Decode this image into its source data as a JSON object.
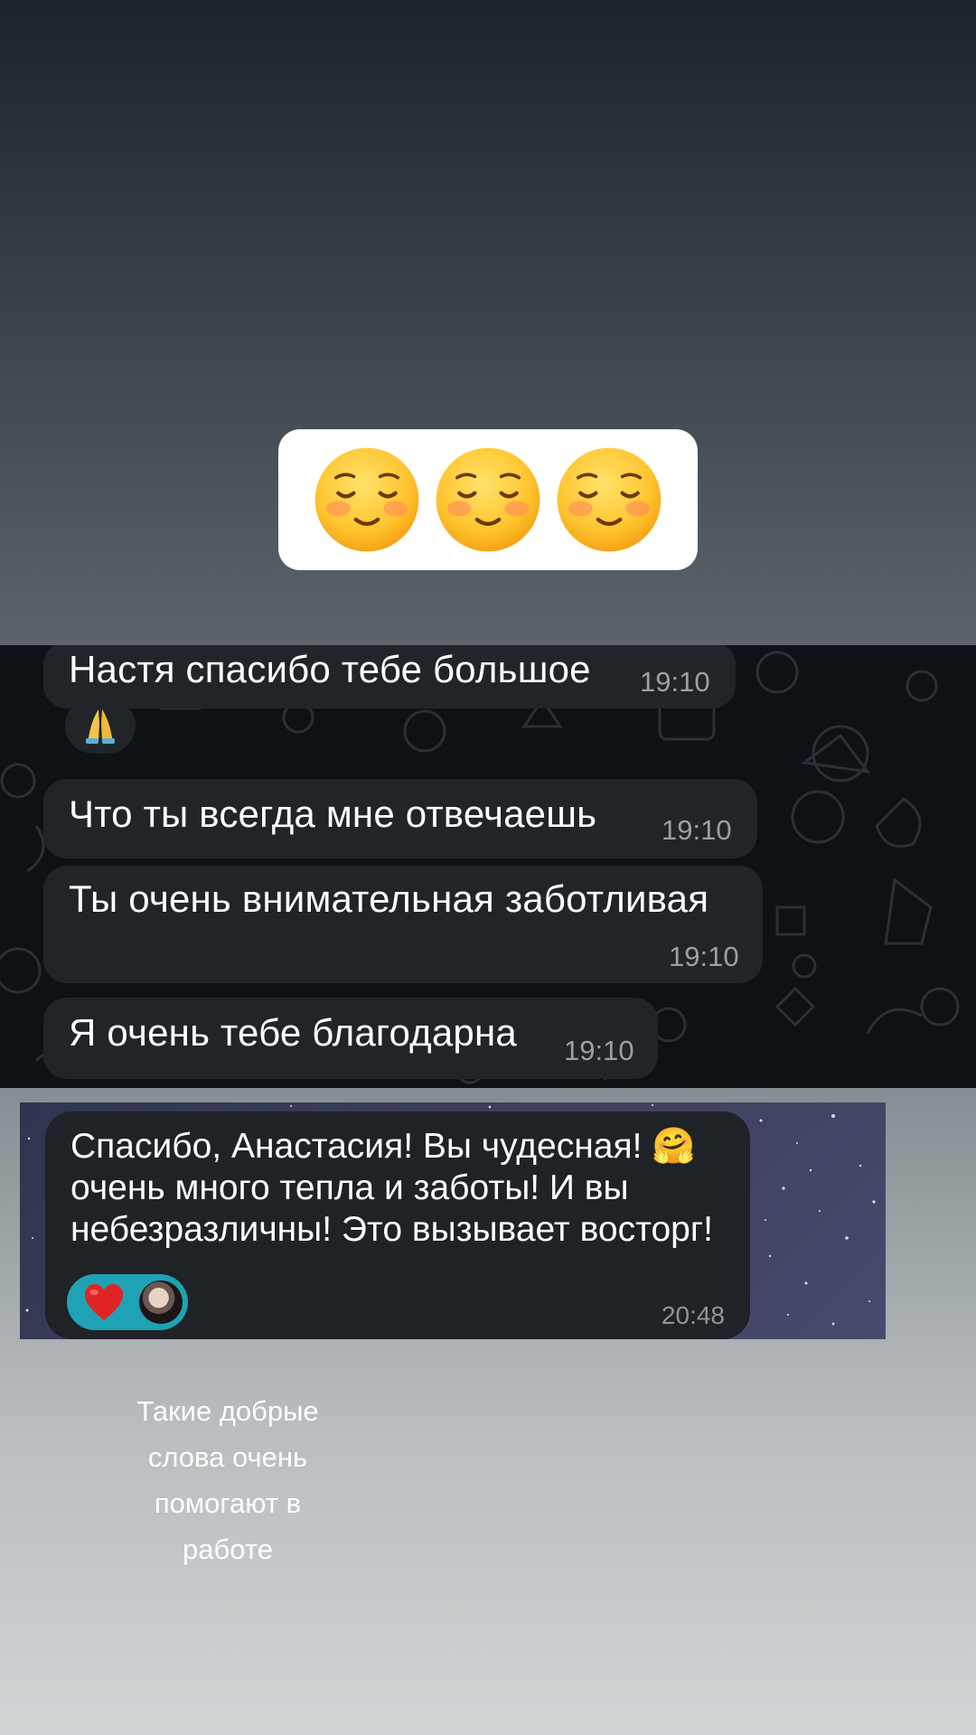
{
  "sticker": {
    "icons": [
      "smiling-face-icon",
      "smiling-face-icon",
      "smiling-face-icon"
    ]
  },
  "chat1": {
    "messages": [
      {
        "text": "Настя спасибо тебе большое",
        "time": "19:10"
      },
      {
        "reaction_icon": "folded-hands-icon"
      },
      {
        "text": "Что ты всегда мне отвечаешь",
        "time": "19:10"
      },
      {
        "text": "Ты очень внимательная заботливая",
        "time": "19:10"
      },
      {
        "text": "Я очень тебе благодарна",
        "time": "19:10"
      }
    ]
  },
  "chat2": {
    "lines": [
      "Спасибо, Анастасия! Вы чудесная! 🤗",
      "очень много тепла и заботы! И вы",
      "небезразличны! Это вызывает восторг!"
    ],
    "reaction_icon": "red-heart-icon",
    "time": "20:48"
  },
  "caption": {
    "lines": [
      "Такие добрые",
      "слова очень",
      "помогают в",
      "работе"
    ]
  }
}
